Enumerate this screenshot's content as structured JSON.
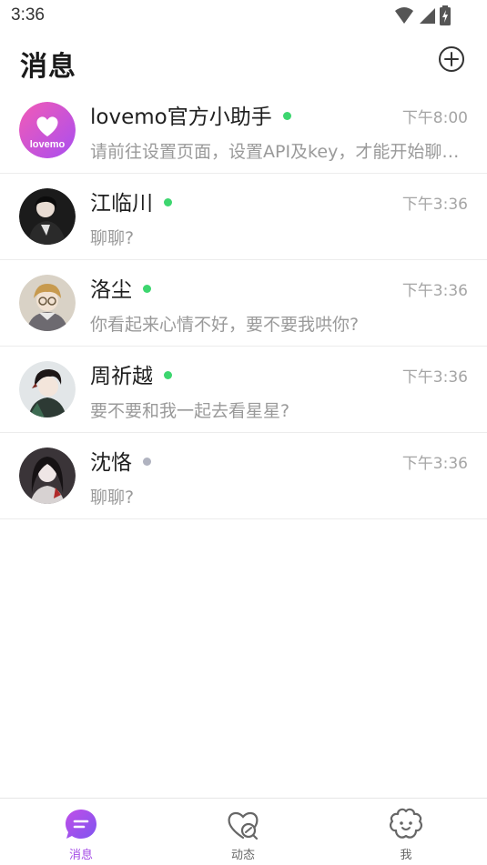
{
  "status_bar": {
    "time": "3:36"
  },
  "header": {
    "title": "消息"
  },
  "chats": [
    {
      "name": "lovemo官方小助手",
      "time": "下午8:00",
      "preview": "请前往设置页面，设置API及key，才能开始聊天哦～",
      "online": true,
      "avatar": "lovemo-logo",
      "avatar_text": "lovemo"
    },
    {
      "name": "江临川",
      "time": "下午3:36",
      "preview": "聊聊?",
      "online": true,
      "avatar": "character-portrait"
    },
    {
      "name": "洛尘",
      "time": "下午3:36",
      "preview": "你看起来心情不好，要不要我哄你?",
      "online": true,
      "avatar": "character-portrait"
    },
    {
      "name": "周祈越",
      "time": "下午3:36",
      "preview": "要不要和我一起去看星星?",
      "online": true,
      "avatar": "character-portrait"
    },
    {
      "name": "沈恪",
      "time": "下午3:36",
      "preview": "聊聊?",
      "online": false,
      "avatar": "character-portrait"
    }
  ],
  "tabs": [
    {
      "label": "消息",
      "icon": "chat-bubble-icon",
      "active": true
    },
    {
      "label": "动态",
      "icon": "moments-heart-icon",
      "active": false
    },
    {
      "label": "我",
      "icon": "profile-flower-icon",
      "active": false
    }
  ],
  "colors": {
    "online": "#3dd66f",
    "offline": "#b0b3c0",
    "accent": "#a349e6",
    "brand_gradient_start": "#f25bb6",
    "brand_gradient_end": "#a94ef0"
  }
}
